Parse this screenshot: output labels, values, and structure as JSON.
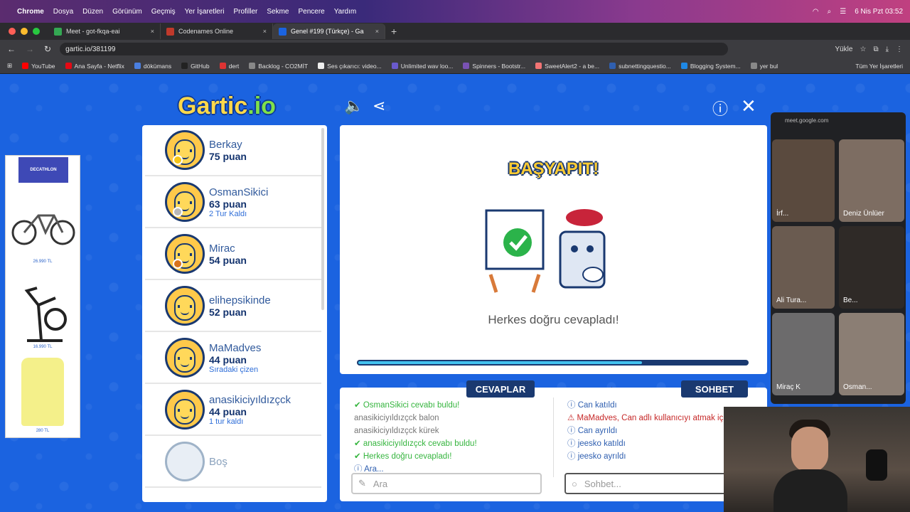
{
  "menubar": {
    "app": "Chrome",
    "items": [
      "Dosya",
      "Düzen",
      "Görünüm",
      "Geçmiş",
      "Yer İşaretleri",
      "Profiller",
      "Sekme",
      "Pencere",
      "Yardım"
    ],
    "datetime": "6 Nis Pzt  03:52"
  },
  "tabs": [
    {
      "title": "Meet - got-fkqa-eai",
      "fav_color": "#34a853"
    },
    {
      "title": "Codenames Online",
      "fav_color": "#c0392b"
    },
    {
      "title": "Genel #199 (Türkçe) - Ga",
      "fav_color": "#1b63e0"
    }
  ],
  "address": {
    "url": "gartic.io/381199",
    "install_label": "Yükle"
  },
  "bookmarks": [
    {
      "label": "YouTube",
      "color": "#ff0000"
    },
    {
      "label": "Ana Sayfa - Netflix",
      "color": "#e50914"
    },
    {
      "label": "dökümans",
      "color": "#4a7fe0"
    },
    {
      "label": "GitHub",
      "color": "#222222"
    },
    {
      "label": "dert",
      "color": "#d33"
    },
    {
      "label": "Backlog - CO2MİT",
      "color": "#888888"
    },
    {
      "label": "Ses çıkarıcı: video...",
      "color": "#eeeeee"
    },
    {
      "label": "Unlimited wav loo...",
      "color": "#6a5acd"
    },
    {
      "label": "Spinners - Bootstr...",
      "color": "#7952b3"
    },
    {
      "label": "SweetAlert2 - a be...",
      "color": "#f27474"
    },
    {
      "label": "subnettingquestio...",
      "color": "#2f5fb0"
    },
    {
      "label": "Blogging System...",
      "color": "#1e88e5"
    },
    {
      "label": "yer bul",
      "color": "#888888"
    }
  ],
  "bookmarks_all": "Tüm Yer İşaretleri",
  "ad": {
    "brand": "DECATHLON",
    "prices": [
      "26.990 TL",
      "16.990 TL",
      "280 TL"
    ]
  },
  "logo": {
    "main": "Gartic",
    "suffix": ".io"
  },
  "players": [
    {
      "name": "Berkay",
      "score": "75 puan",
      "status": "",
      "badge": "#f5c518"
    },
    {
      "name": "OsmanSikici",
      "score": "63 puan",
      "status": "2 Tur Kaldı",
      "badge": "#b8b8b8"
    },
    {
      "name": "Mirac",
      "score": "54 puan",
      "status": "",
      "badge": "#d8731c"
    },
    {
      "name": "elihepsikinde",
      "score": "52 puan",
      "status": "",
      "badge": ""
    },
    {
      "name": "MaMadves",
      "score": "44 puan",
      "status": "Sıradaki çizen",
      "badge": ""
    },
    {
      "name": "anasikiciyıldızçck",
      "score": "44 puan",
      "status": "1 tur kaldı",
      "badge": ""
    },
    {
      "name": "Boş",
      "score": "",
      "status": "",
      "badge": ""
    }
  ],
  "board": {
    "headline": "BAŞYAPIT!",
    "message": "Herkes doğru cevapladı!",
    "progress": 0.73
  },
  "answers": {
    "tab_answers": "CEVAPLAR",
    "tab_chat": "SOHBET",
    "left_lines": [
      {
        "text": "OsmanSikici cevabı buldu!",
        "cls": "green",
        "icon": "check"
      },
      {
        "text": "anasikiciyıldızçck balon",
        "cls": "grey",
        "icon": ""
      },
      {
        "text": "anasikiciyıldızçck kürek",
        "cls": "grey",
        "icon": ""
      },
      {
        "text": "anasikiciyıldızçck cevabı buldu!",
        "cls": "green",
        "icon": "check"
      },
      {
        "text": "Herkes doğru cevapladı!",
        "cls": "green",
        "icon": "check"
      },
      {
        "text": "Ara...",
        "cls": "blue",
        "icon": "info"
      }
    ],
    "right_lines": [
      {
        "text": "Can katıldı",
        "cls": "blue",
        "icon": "info"
      },
      {
        "text": "MaMadves, Can adlı kullanıcıyı atmak için oy verdi",
        "cls": "red",
        "icon": "warn"
      },
      {
        "text": "Can ayrıldı",
        "cls": "blue",
        "icon": "info"
      },
      {
        "text": "jeesko katıldı",
        "cls": "blue",
        "icon": "info"
      },
      {
        "text": "jeesko ayrıldı",
        "cls": "blue",
        "icon": "info"
      }
    ],
    "answer_placeholder": "Ara",
    "chat_placeholder": "Sohbet..."
  },
  "meet": {
    "host": "meet.google.com",
    "tiles": [
      "İrf...",
      "Deniz Ünlüer",
      "Ali Tura...",
      "Be...",
      "Miraç K",
      "Osman..."
    ]
  }
}
